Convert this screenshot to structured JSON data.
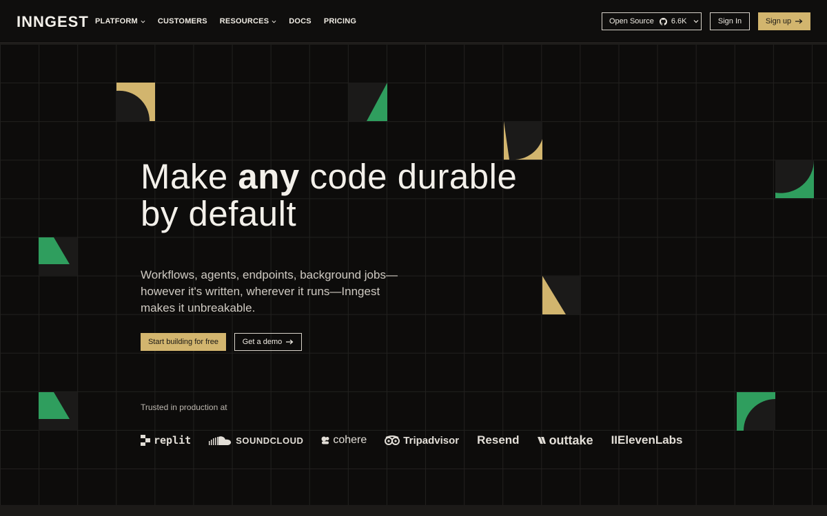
{
  "header": {
    "logo": "INNGEST",
    "nav": [
      {
        "label": "PLATFORM",
        "has_dropdown": true
      },
      {
        "label": "CUSTOMERS",
        "has_dropdown": false
      },
      {
        "label": "RESOURCES",
        "has_dropdown": true
      },
      {
        "label": "DOCS",
        "has_dropdown": false
      },
      {
        "label": "PRICING",
        "has_dropdown": false
      }
    ],
    "open_source": {
      "label": "Open Source",
      "stars": "6.6K"
    },
    "sign_in": "Sign In",
    "sign_up": "Sign up"
  },
  "hero": {
    "headline_pre": "Make ",
    "headline_emphasis": "any",
    "headline_post": " code durable",
    "headline_line2": "by default",
    "subtitle_line1": "Workflows, agents, endpoints, background jobs—",
    "subtitle_line2": "however it's written, wherever it runs—Inngest",
    "subtitle_line3": "makes it unbreakable.",
    "cta_primary": "Start building for free",
    "cta_secondary": "Get a demo"
  },
  "trusted": {
    "label": "Trusted in production at",
    "logos": [
      "replit",
      "SOUNDCLOUD",
      "cohere",
      "Tripadvisor",
      "Resend",
      "outtake",
      "IIElevenLabs"
    ]
  },
  "colors": {
    "background": "#0d0c0b",
    "accent_gold": "#d2b56e",
    "accent_green": "#2f9e5e"
  },
  "icons": [
    "chevron-down-icon",
    "github-icon",
    "arrow-right-icon"
  ]
}
